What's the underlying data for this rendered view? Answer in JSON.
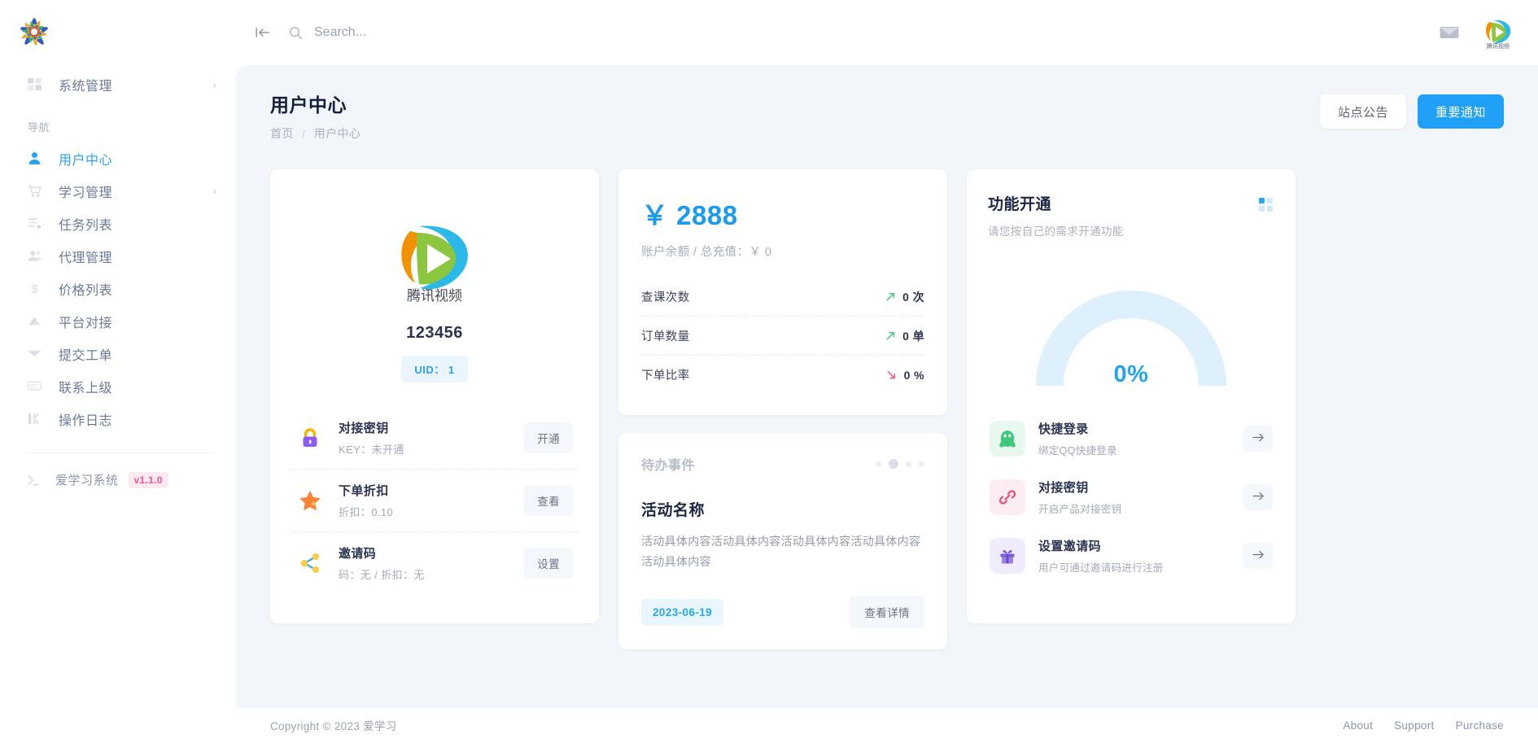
{
  "sidebar": {
    "logo_name": "app-logo",
    "top_items": [
      {
        "label": "系统管理",
        "icon": "grid-icon",
        "has_chevron": true
      }
    ],
    "nav_caption": "导航",
    "items": [
      {
        "label": "用户中心",
        "icon": "user-icon",
        "active": true,
        "has_chevron": false
      },
      {
        "label": "学习管理",
        "icon": "cart-icon",
        "active": false,
        "has_chevron": true
      },
      {
        "label": "任务列表",
        "icon": "tasklist-icon",
        "active": false,
        "has_chevron": false
      },
      {
        "label": "代理管理",
        "icon": "users-icon",
        "active": false,
        "has_chevron": false
      },
      {
        "label": "价格列表",
        "icon": "dollar-icon",
        "active": false,
        "has_chevron": false
      },
      {
        "label": "平台对接",
        "icon": "cloud-icon",
        "active": false,
        "has_chevron": false
      },
      {
        "label": "提交工单",
        "icon": "envelope-icon",
        "active": false,
        "has_chevron": false
      },
      {
        "label": "联系上级",
        "icon": "chat-icon",
        "active": false,
        "has_chevron": false
      },
      {
        "label": "操作日志",
        "icon": "chart-bar-icon",
        "active": false,
        "has_chevron": false
      }
    ],
    "footer": {
      "icon": "terminal-icon",
      "label": "爱学习系统",
      "version": "v1.1.0"
    }
  },
  "topbar": {
    "collapse_icon": "collapse-left-icon",
    "search_icon": "search-icon",
    "search_value": "",
    "search_placeholder": "Search...",
    "mail_icon": "envelope-icon",
    "avatar_icon": "tencent-video-avatar"
  },
  "page": {
    "title": "用户中心",
    "breadcrumb": {
      "root": "首页",
      "sep": "/",
      "current": "用户中心"
    },
    "actions": {
      "secondary": "站点公告",
      "primary": "重要通知"
    }
  },
  "profile": {
    "logo_icon": "tencent-video-logo",
    "name": "123456",
    "uid_badge": "UID： 1",
    "rows": [
      {
        "icon": "lock-icon",
        "title": "对接密钥",
        "sub": "KEY：未开通",
        "button": "开通"
      },
      {
        "icon": "star-icon",
        "title": "下单折扣",
        "sub": "折扣：0.10",
        "button": "查看"
      },
      {
        "icon": "share-icon",
        "title": "邀请码",
        "sub": "码：无 / 折扣：无",
        "button": "设置"
      }
    ]
  },
  "balance": {
    "amount": "￥ 2888",
    "sub": "账户余额 / 总充值：￥ 0",
    "rows": [
      {
        "label": "查课次数",
        "value": "0 次",
        "trend": "up-arrow-icon",
        "trend_color": "#4cc47f"
      },
      {
        "label": "订单数量",
        "value": "0 单",
        "trend": "up-arrow-icon",
        "trend_color": "#4cc47f"
      },
      {
        "label": "下单比率",
        "value": "0 %",
        "trend": "down-arrow-icon",
        "trend_color": "#f2557e"
      }
    ]
  },
  "events": {
    "header": "待办事件",
    "dots": 4,
    "active_dot": 1,
    "title": "活动名称",
    "desc": "活动具体内容活动具体内容活动具体内容活动具体内容活动具体内容",
    "date": "2023-06-19",
    "button": "查看详情"
  },
  "features": {
    "title": "功能开通",
    "sub": "请您按自己的需求开通功能",
    "grid_icon": "grid-squares-icon",
    "gauge": {
      "percent_label": "0%",
      "value": 0,
      "track_color": "#dff0fd",
      "fill_color": "#21a5f2"
    },
    "rows": [
      {
        "icon": "qq-penguin-icon",
        "icon_bg": "#e7f9ee",
        "icon_color": "#3ec97d",
        "title": "快捷登录",
        "sub": "绑定QQ快捷登录",
        "arrow": "arrow-right-icon"
      },
      {
        "icon": "link-icon",
        "icon_bg": "#fdecf1",
        "icon_color": "#f04870",
        "title": "对接密钥",
        "sub": "开启产品对接密钥",
        "arrow": "arrow-right-icon"
      },
      {
        "icon": "gift-icon",
        "icon_bg": "#f1ecfd",
        "icon_color": "#7b5cd6",
        "title": "设置邀请码",
        "sub": "用户可通过邀请码进行注册",
        "arrow": "arrow-right-icon"
      }
    ]
  },
  "footer": {
    "copyright": "Copyright © 2023 爱学习",
    "links": [
      "About",
      "Support",
      "Purchase"
    ]
  }
}
